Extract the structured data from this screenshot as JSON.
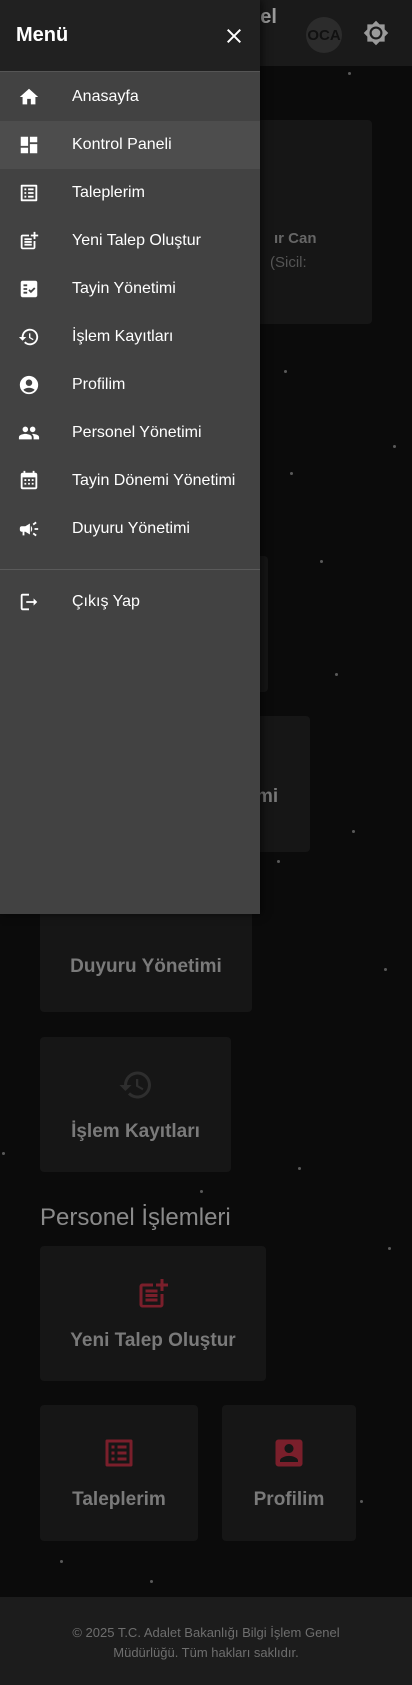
{
  "app": {
    "brand_fragment": "nel",
    "avatar_initials": "OCA"
  },
  "welcome": {
    "line1": "ır Can",
    "line2": "(Sicil:"
  },
  "stubs": {
    "tail_text": "mi"
  },
  "cards": {
    "duyuru": "Duyuru Yönetimi",
    "islem": "İşlem Kayıtları",
    "yeni_talep": "Yeni Talep Oluştur",
    "taleplerim": "Taleplerim",
    "profilim": "Profilim"
  },
  "section": {
    "personel_title": "Personel İşlemleri"
  },
  "drawer": {
    "title": "Menü",
    "items": [
      {
        "label": "Anasayfa",
        "icon": "home-icon"
      },
      {
        "label": "Kontrol Paneli",
        "icon": "dashboard-icon"
      },
      {
        "label": "Taleplerim",
        "icon": "list-icon"
      },
      {
        "label": "Yeni Talep Oluştur",
        "icon": "post-add-icon"
      },
      {
        "label": "Tayin Yönetimi",
        "icon": "checklist-icon"
      },
      {
        "label": "İşlem Kayıtları",
        "icon": "history-icon"
      },
      {
        "label": "Profilim",
        "icon": "account-circle-icon"
      },
      {
        "label": "Personel Yönetimi",
        "icon": "people-icon"
      },
      {
        "label": "Tayin Dönemi Yönetimi",
        "icon": "calendar-icon"
      },
      {
        "label": "Duyuru Yönetimi",
        "icon": "campaign-icon"
      }
    ],
    "logout": "Çıkış Yap"
  },
  "footer": {
    "line1": "© 2025 T.C. Adalet Bakanlığı Bilgi İşlem Genel",
    "line2": "Müdürlüğü. Tüm hakları saklıdır."
  },
  "colors": {
    "accent_red": "#7a1f2b",
    "drawer_bg": "#424242",
    "header_bg": "#212121"
  }
}
